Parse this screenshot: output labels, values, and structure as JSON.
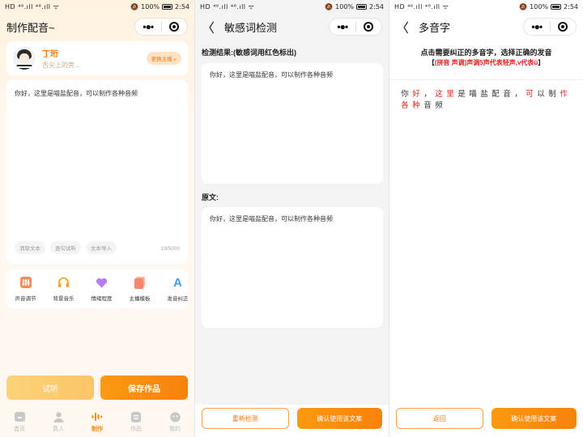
{
  "status": {
    "left": "HD ⁴⁶.ıll ⁴⁶.ıll ᯤ",
    "right_icon": "mute-icon",
    "battery": "100%",
    "time": "2:54"
  },
  "screen1": {
    "title": "制作配音~",
    "anchor": {
      "name": "丁珩",
      "subtitle": "舌尖上的旁…",
      "change": "更换主播 »"
    },
    "editor": {
      "text": "你好，这里是喵盐配音，可以制作各种音频"
    },
    "actions": [
      "清除文本",
      "逐句试听",
      "文本导入"
    ],
    "counter": "19/5000",
    "tools": [
      {
        "label": "声音调节",
        "icon": "sliders-icon",
        "color": "#f28b5a"
      },
      {
        "label": "背景音乐",
        "icon": "headphones-icon",
        "color": "#f6a623"
      },
      {
        "label": "情绪程度",
        "icon": "heart-icon",
        "color": "#b57bf2"
      },
      {
        "label": "主播模板",
        "icon": "document-icon",
        "color": "#f4876a"
      },
      {
        "label": "发音纠正",
        "icon": "letter-a-icon",
        "color": "#3d9df5"
      }
    ],
    "listen": "试听",
    "save": "保存作品",
    "tabs": [
      {
        "label": "首页",
        "icon": "home-icon"
      },
      {
        "label": "真人",
        "icon": "person-icon"
      },
      {
        "label": "制作",
        "icon": "waveform-icon"
      },
      {
        "label": "作品",
        "icon": "list-icon"
      },
      {
        "label": "我的",
        "icon": "face-icon"
      }
    ]
  },
  "screen2": {
    "title": "敏感词检测",
    "result_label": "检测结果:(敏感词用红色标出)",
    "result_text": "你好，这里是喵盐配音，可以制作各种音频",
    "original_label": "原文:",
    "original_text": "你好，这里是喵盐配音，可以制作各种音频",
    "redetect": "重新检测",
    "confirm": "确认使用该文案"
  },
  "screen3": {
    "title": "多音字",
    "instruction": "点击需要纠正的多音字，选择正确的发音",
    "hint_open": "【",
    "hint_red": "(拼音 声调)声调5声代表轻声,v代表ü",
    "hint_close": "】",
    "chars": [
      {
        "c": "你",
        "poly": false
      },
      {
        "c": "好",
        "poly": true
      },
      {
        "c": "，",
        "poly": false
      },
      {
        "c": "这",
        "poly": true
      },
      {
        "c": "里",
        "poly": true
      },
      {
        "c": "是",
        "poly": false
      },
      {
        "c": "喵",
        "poly": false
      },
      {
        "c": "盐",
        "poly": false
      },
      {
        "c": "配",
        "poly": false
      },
      {
        "c": "音",
        "poly": false
      },
      {
        "c": "，",
        "poly": false
      },
      {
        "c": "可",
        "poly": true
      },
      {
        "c": "以",
        "poly": false
      },
      {
        "c": "制",
        "poly": false
      },
      {
        "c": "作",
        "poly": true
      },
      {
        "c": "各",
        "poly": true
      },
      {
        "c": "种",
        "poly": true
      },
      {
        "c": "音",
        "poly": false
      },
      {
        "c": "频",
        "poly": false
      }
    ],
    "back": "返回",
    "confirm": "确认使用该文案"
  },
  "colors": {
    "accent": "#f7820b",
    "accent_light": "#fcd37a",
    "poly_red": "#e02020",
    "tab_inactive": "#bbbbbb"
  }
}
